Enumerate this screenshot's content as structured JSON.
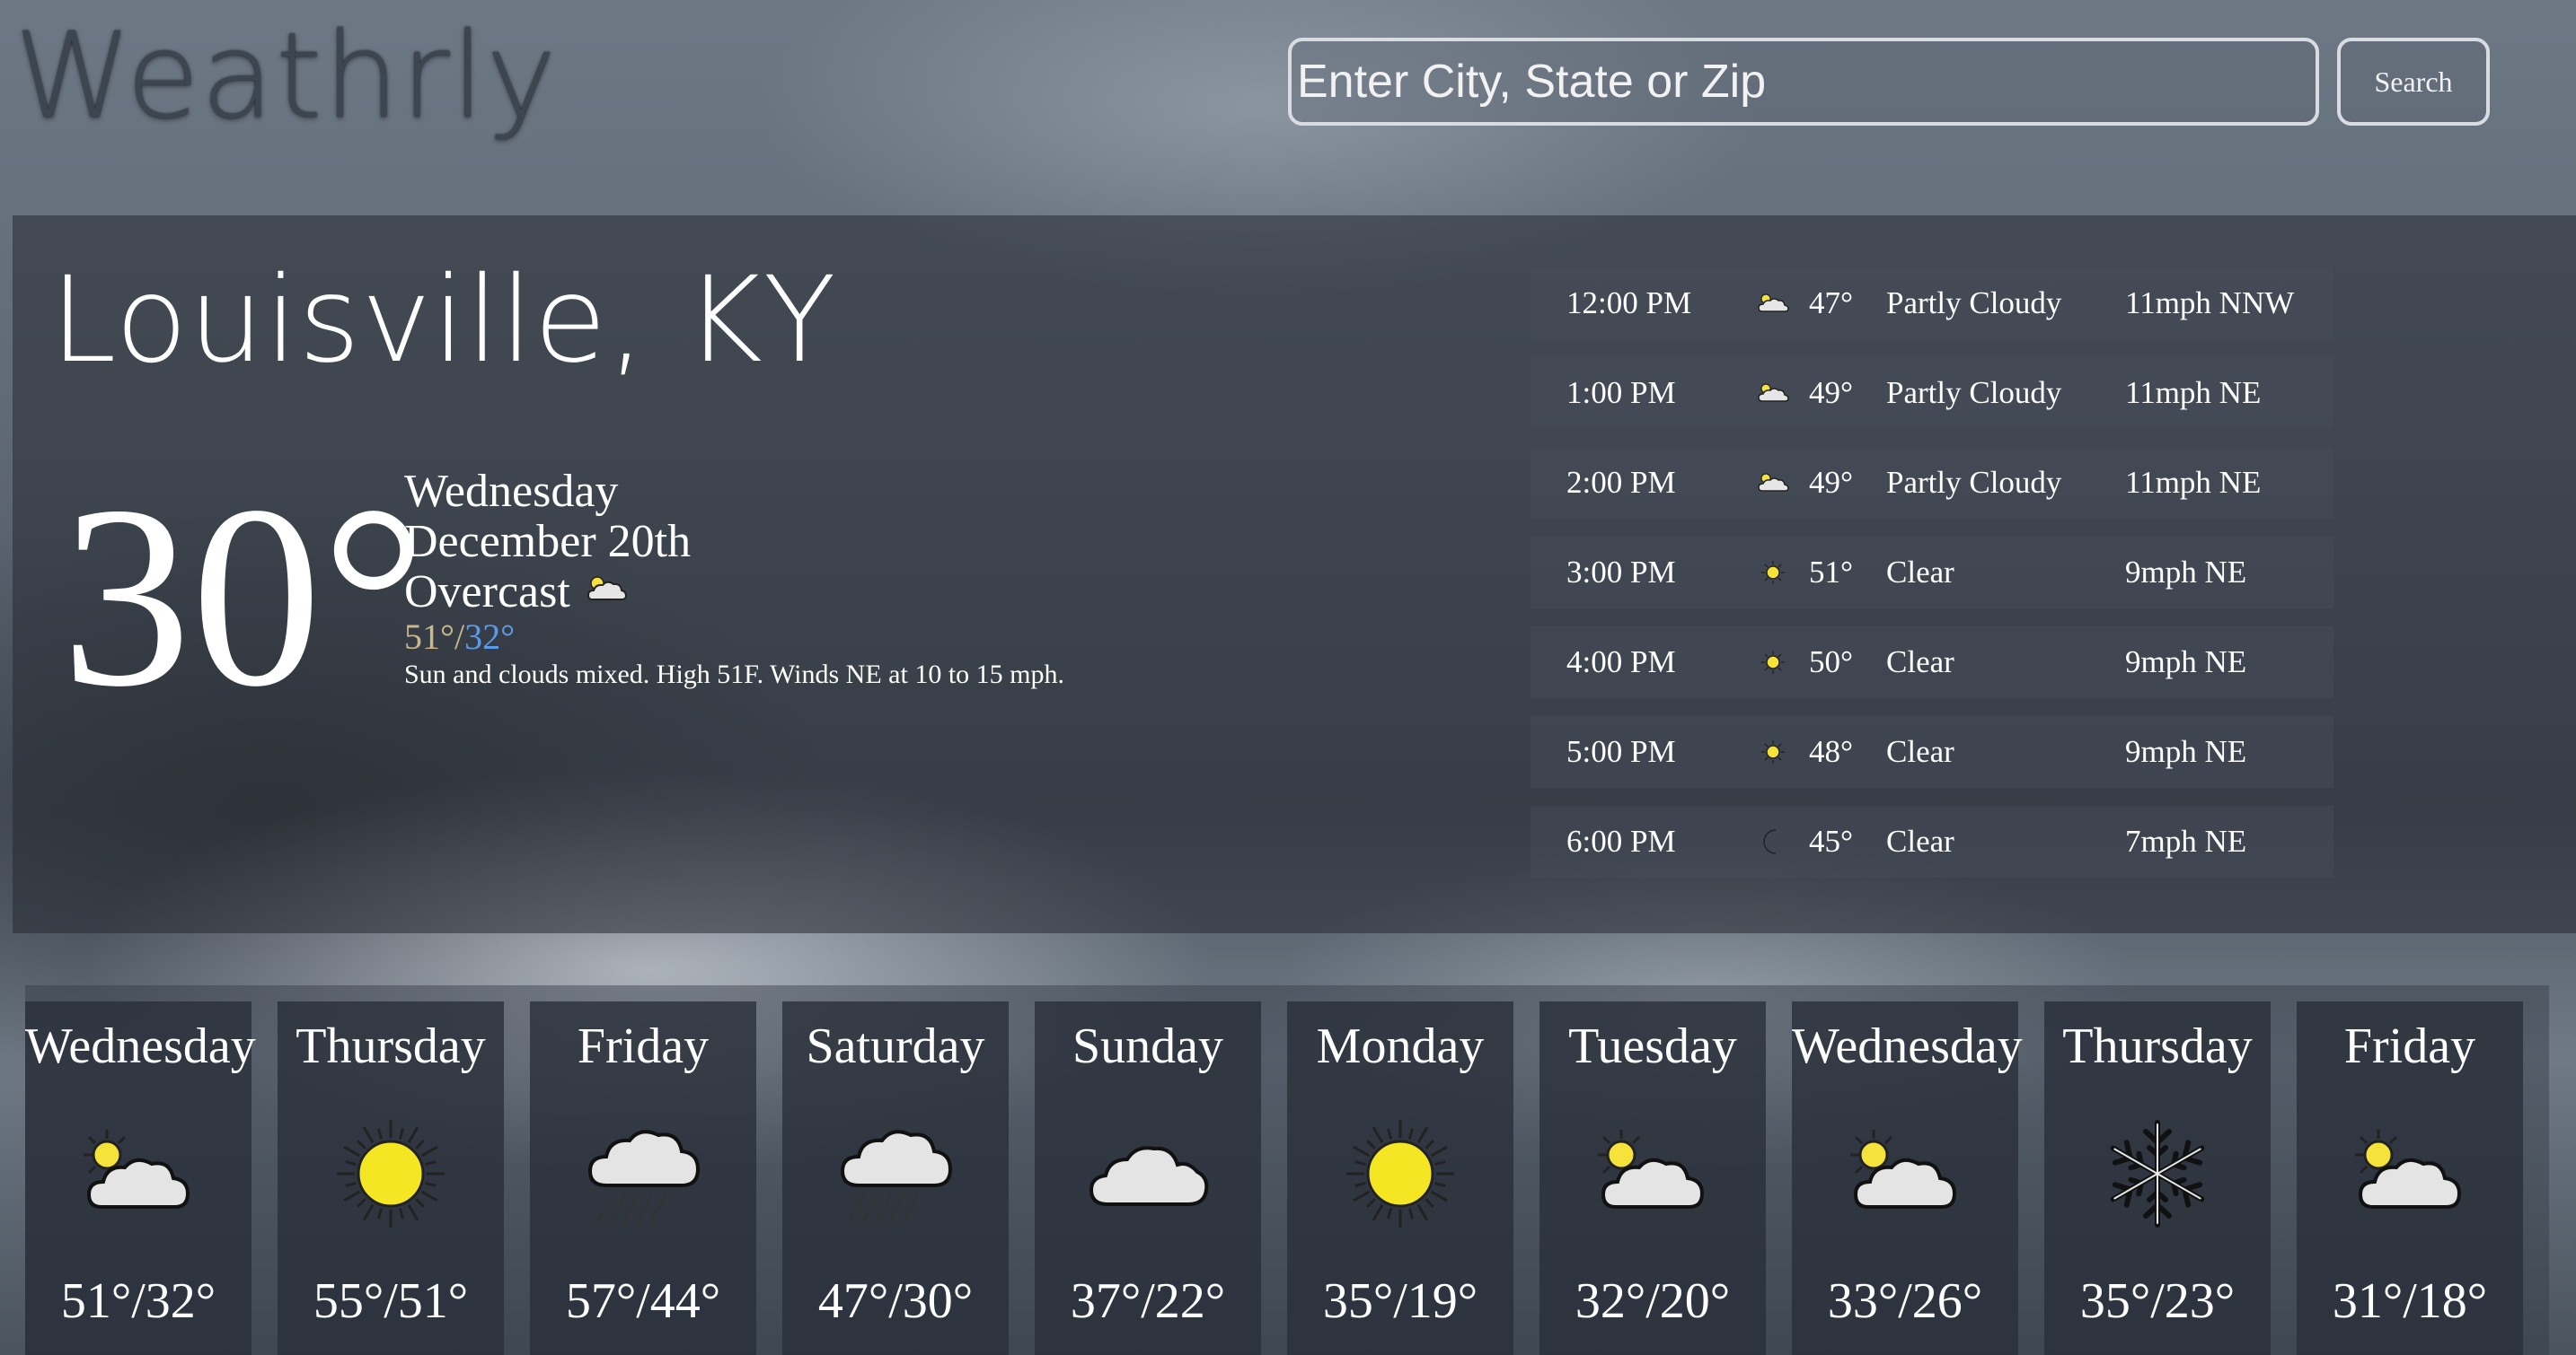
{
  "header": {
    "logo_text": "Weathrly",
    "search_placeholder": "Enter City, State or Zip",
    "search_button": "Search"
  },
  "current": {
    "city": "Louisville, KY",
    "temp": "30°",
    "day": "Wednesday",
    "date": "December 20th",
    "condition": "Overcast",
    "condition_icon": "partly-cloudy-icon",
    "high": "51°",
    "separator": "/",
    "low": "32°",
    "summary": "Sun and clouds mixed. High 51F. Winds NE at 10 to 15 mph."
  },
  "hourly": [
    {
      "time": "12:00 PM",
      "icon": "partly-cloudy-icon",
      "temp": "47°",
      "condition": "Partly Cloudy",
      "wind": "11mph NNW"
    },
    {
      "time": "1:00 PM",
      "icon": "partly-cloudy-icon",
      "temp": "49°",
      "condition": "Partly Cloudy",
      "wind": "11mph NE"
    },
    {
      "time": "2:00 PM",
      "icon": "partly-cloudy-icon",
      "temp": "49°",
      "condition": "Partly Cloudy",
      "wind": "11mph NE"
    },
    {
      "time": "3:00 PM",
      "icon": "sun-icon",
      "temp": "51°",
      "condition": "Clear",
      "wind": "9mph NE"
    },
    {
      "time": "4:00 PM",
      "icon": "sun-icon",
      "temp": "50°",
      "condition": "Clear",
      "wind": "9mph NE"
    },
    {
      "time": "5:00 PM",
      "icon": "sun-icon",
      "temp": "48°",
      "condition": "Clear",
      "wind": "9mph NE"
    },
    {
      "time": "6:00 PM",
      "icon": "moon-icon",
      "temp": "45°",
      "condition": "Clear",
      "wind": "7mph NE"
    }
  ],
  "daily": [
    {
      "day": "Wednesday",
      "icon": "partly-cloudy-icon",
      "temps": "51°/32°"
    },
    {
      "day": "Thursday",
      "icon": "sun-icon",
      "temps": "55°/51°"
    },
    {
      "day": "Friday",
      "icon": "rain-icon",
      "temps": "57°/44°"
    },
    {
      "day": "Saturday",
      "icon": "rain-icon",
      "temps": "47°/30°"
    },
    {
      "day": "Sunday",
      "icon": "cloud-icon",
      "temps": "37°/22°"
    },
    {
      "day": "Monday",
      "icon": "sun-icon",
      "temps": "35°/19°"
    },
    {
      "day": "Tuesday",
      "icon": "partly-cloudy-icon",
      "temps": "32°/20°"
    },
    {
      "day": "Wednesday",
      "icon": "partly-cloudy-icon",
      "temps": "33°/26°"
    },
    {
      "day": "Thursday",
      "icon": "snowflake-icon",
      "temps": "35°/23°"
    },
    {
      "day": "Friday",
      "icon": "partly-cloudy-icon",
      "temps": "31°/18°"
    }
  ]
}
